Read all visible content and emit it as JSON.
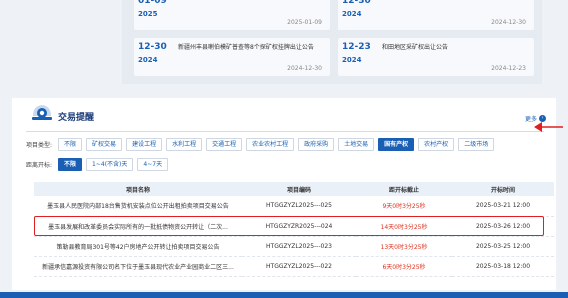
{
  "news": {
    "cards": [
      {
        "md": "01-09",
        "yr": "2025",
        "title": "",
        "pubdate": "2025-01-09"
      },
      {
        "md": "12-30",
        "yr": "2024",
        "title": "",
        "pubdate": "2024-12-30"
      },
      {
        "md": "12-30",
        "yr": "2024",
        "title": "新疆州丰县喇伯模矿普查等8个探矿权挂牌出让公告",
        "pubdate": "2024-12-30"
      },
      {
        "md": "12-23",
        "yr": "2024",
        "title": "和田地区采矿权出让公告",
        "pubdate": "2024-12-23"
      }
    ]
  },
  "trade": {
    "title": "交易提醒",
    "more_label": "更多",
    "filters": {
      "type_label": "项目类型:",
      "types": [
        "不限",
        "矿权交易",
        "建设工程",
        "水利工程",
        "交通工程",
        "农业农村工程",
        "政府采购",
        "土地交易",
        "国有产权",
        "农村产权",
        "二级市场"
      ],
      "active_type_index": 8,
      "distance_label": "距离开标:",
      "distances": [
        "不限",
        "1~4(不含)天",
        "4~7天"
      ],
      "active_distance_index": 0
    },
    "table": {
      "headers": [
        "项目名称",
        "项目编码",
        "距开标截止",
        "开标时间"
      ],
      "rows": [
        {
          "name": "墨玉县人民医院内部18台售货机安装点位公开出租拍卖项目交易公告",
          "code": "HTGGZYZL2025---025",
          "countdown": "9天0时3分25秒",
          "time": "2025-03-21 12:00"
        },
        {
          "name": "墨玉县发展和改革委员会实际所有的一批抵债物资公开转让（二次...",
          "code": "HTGGZYZR2025---024",
          "countdown": "14天0时3分25秒",
          "time": "2025-03-26 12:00"
        },
        {
          "name": "策勒县教育局301号等42户房地产公开转让拍卖项目交易公告",
          "code": "HTGGZYZL2025---023",
          "countdown": "13天0时3分25秒",
          "time": "2025-03-25 12:00"
        },
        {
          "name": "新疆承信嘉源投资有限公司名下位于墨玉县现代农业产业园商业二区三...",
          "code": "HTGGZYZL2025---022",
          "countdown": "6天0时3分25秒",
          "time": "2025-03-18 12:00"
        }
      ]
    }
  },
  "colors": {
    "accent": "#1a5fb4",
    "countdown": "#e0301e",
    "highlight": "#e02020"
  }
}
